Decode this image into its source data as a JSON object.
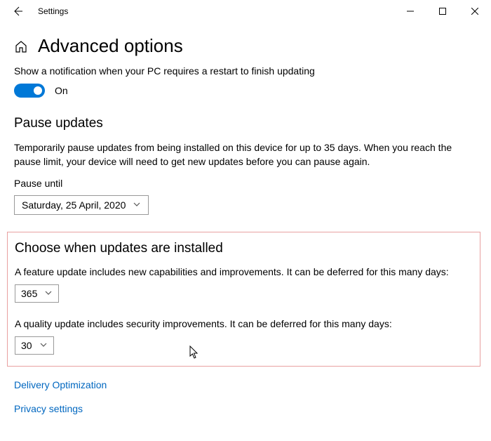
{
  "titlebar": {
    "appname": "Settings"
  },
  "page": {
    "title": "Advanced options"
  },
  "restart": {
    "desc": "Show a notification when your PC requires a restart to finish updating",
    "toggle_label": "On"
  },
  "pause": {
    "title": "Pause updates",
    "body": "Temporarily pause updates from being installed on this device for up to 35 days. When you reach the pause limit, your device will need to get new updates before you can pause again.",
    "until_label": "Pause until",
    "until_value": "Saturday, 25 April, 2020"
  },
  "choose": {
    "title": "Choose when updates are installed",
    "feature_desc": "A feature update includes new capabilities and improvements. It can be deferred for this many days:",
    "feature_value": "365",
    "quality_desc": "A quality update includes security improvements. It can be deferred for this many days:",
    "quality_value": "30"
  },
  "links": {
    "delivery": "Delivery Optimization",
    "privacy": "Privacy settings"
  }
}
